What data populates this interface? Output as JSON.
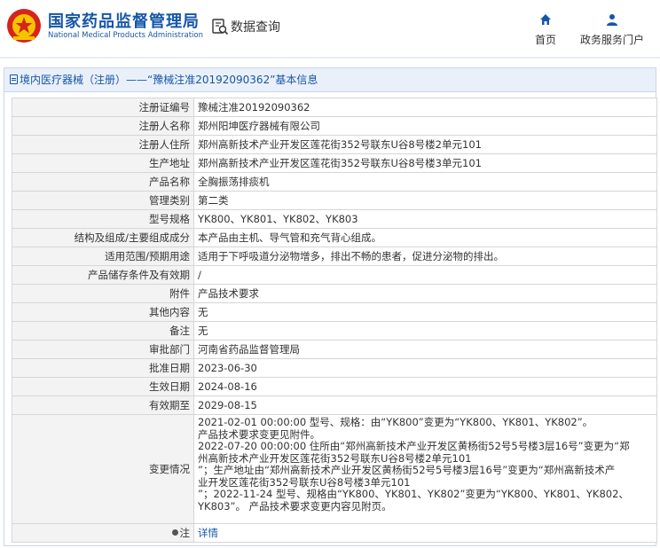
{
  "header": {
    "brand_cn": "国家药品监督管理局",
    "brand_en": "National Medical Products Administration",
    "query_title": "数据查询",
    "nav_home": "首页",
    "nav_services": "政务服务门户",
    "brand_color": "#1656a8",
    "emblem_color": "#d6241b"
  },
  "breadcrumb": "境内医疗器械（注册）——“豫械注准20192090362”基本信息",
  "rows": [
    {
      "label": "注册证编号",
      "value": "豫械注准20192090362"
    },
    {
      "label": "注册人名称",
      "value": "郑州阳坤医疗器械有限公司"
    },
    {
      "label": "注册人住所",
      "value": "郑州高新技术产业开发区莲花街352号联东U谷8号楼2单元101"
    },
    {
      "label": "生产地址",
      "value": "郑州高新技术产业开发区莲花街352号联东U谷8号楼3单元101"
    },
    {
      "label": "产品名称",
      "value": "全胸振荡排痰机"
    },
    {
      "label": "管理类别",
      "value": "第二类"
    },
    {
      "label": "型号规格",
      "value": "YK800、YK801、YK802、YK803"
    },
    {
      "label": "结构及组成/主要组成成分",
      "value": "本产品由主机、导气管和充气背心组成。"
    },
    {
      "label": "适用范围/预期用途",
      "value": "适用于下呼吸道分泌物增多，排出不畅的患者，促进分泌物的排出。"
    },
    {
      "label": "产品储存条件及有效期",
      "value": "/"
    },
    {
      "label": "附件",
      "value": "产品技术要求"
    },
    {
      "label": "其他内容",
      "value": "无"
    },
    {
      "label": "备注",
      "value": "无"
    },
    {
      "label": "审批部门",
      "value": "河南省药品监督管理局"
    },
    {
      "label": "批准日期",
      "value": "2023-06-30"
    },
    {
      "label": "生效日期",
      "value": "2024-08-16"
    },
    {
      "label": "有效期至",
      "value": "2029-08-15"
    }
  ],
  "change": {
    "label": "变更情况",
    "lines": [
      "2021-02-01 00:00:00 型号、规格：由“YK800”变更为“YK800、YK801、YK802”。",
      "产品技术要求变更见附件。",
      "2022-07-20 00:00:00 住所由“郑州高新技术产业开发区黄杨街52号5号楼3层16号”变更为“郑",
      "州高新技术产业开发区莲花街352号联东U谷8号楼2单元101",
      "”；生产地址由“郑州高新技术产业开发区黄杨街52号5号楼3层16号”变更为“郑州高新技术产",
      "业开发区莲花街352号联东U谷8号楼3单元101",
      "”；2022-11-24 型号、规格由“YK800、YK801、YK802”变更为“YK800、YK801、YK802、",
      "YK803”。 产品技术要求变更内容见附页。"
    ]
  },
  "note": {
    "label": "注",
    "link": "详情"
  }
}
